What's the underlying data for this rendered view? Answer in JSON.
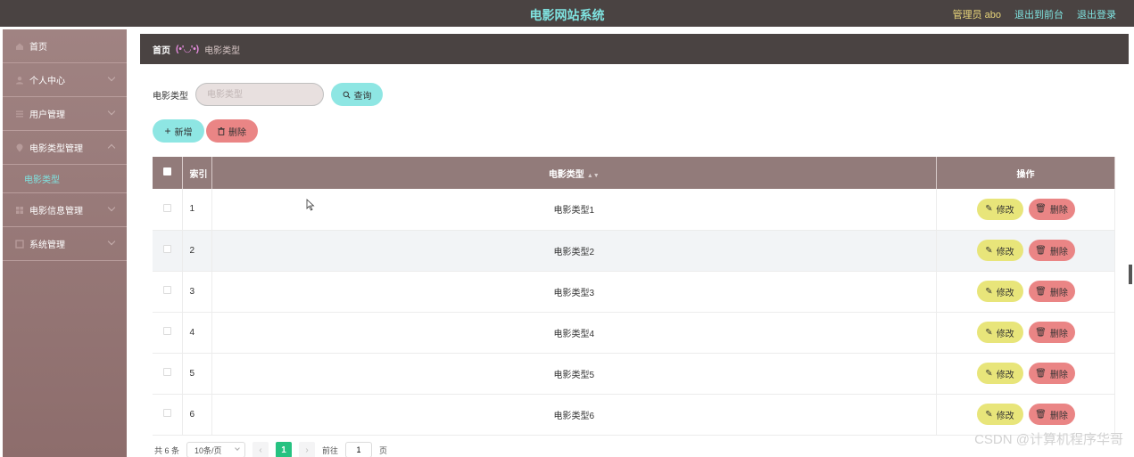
{
  "header": {
    "title": "电影网站系统",
    "admin": "管理员 abo",
    "back_front": "退出到前台",
    "logout": "退出登录"
  },
  "sidebar": {
    "items": [
      {
        "label": "首页",
        "icon": "home-icon"
      },
      {
        "label": "个人中心",
        "icon": "user-icon"
      },
      {
        "label": "用户管理",
        "icon": "list-icon"
      },
      {
        "label": "电影类型管理",
        "icon": "pin-icon"
      },
      {
        "label": "电影信息管理",
        "icon": "grid-icon"
      },
      {
        "label": "系统管理",
        "icon": "settings-icon"
      }
    ],
    "sub_item": "电影类型"
  },
  "breadcrumb": {
    "home": "首页",
    "separator": "(•'◡'•)",
    "current": "电影类型"
  },
  "search": {
    "label": "电影类型",
    "placeholder": "电影类型",
    "query_button": "查询"
  },
  "actions": {
    "add": "新增",
    "delete": "删除"
  },
  "table": {
    "headers": {
      "index": "索引",
      "type": "电影类型",
      "ops": "操作"
    },
    "rows": [
      {
        "index": "1",
        "type": "电影类型1"
      },
      {
        "index": "2",
        "type": "电影类型2"
      },
      {
        "index": "3",
        "type": "电影类型3"
      },
      {
        "index": "4",
        "type": "电影类型4"
      },
      {
        "index": "5",
        "type": "电影类型5"
      },
      {
        "index": "6",
        "type": "电影类型6"
      }
    ],
    "edit_label": "修改",
    "delete_label": "删除"
  },
  "pagination": {
    "total": "共 6 条",
    "page_size": "10条/页",
    "prev": "‹",
    "current_page": "1",
    "next": "›",
    "goto_label": "前往",
    "goto_value": "1",
    "page_suffix": "页"
  },
  "watermark": "CSDN @计算机程序华哥",
  "colors": {
    "header_bg": "#4a4342",
    "accent_cyan": "#8ee6e3",
    "danger": "#ea8585",
    "edit_yellow": "#e8e57a",
    "table_header": "#927b7a",
    "active_page": "#26c281"
  }
}
